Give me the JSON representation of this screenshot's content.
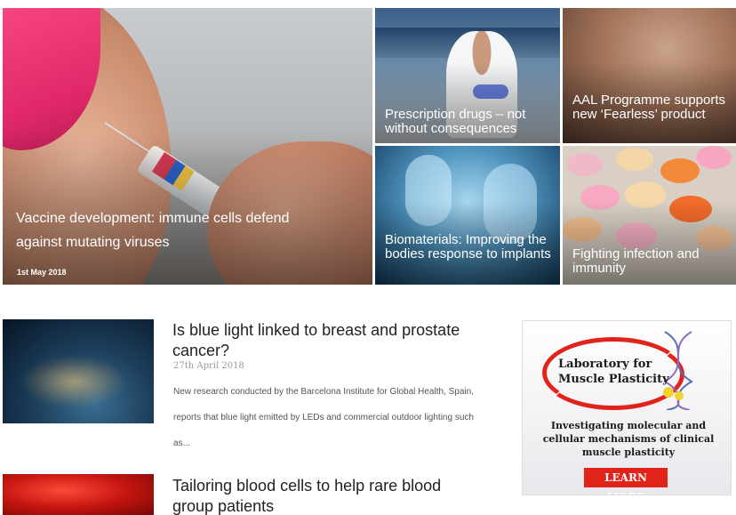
{
  "hero": {
    "title": "Vaccine development: immune cells defend against mutating viruses",
    "date": "1st May 2018"
  },
  "tiles": [
    {
      "label": "Prescription drugs – not without consequences"
    },
    {
      "label": "AAL Programme supports new ‘Fearless’ product"
    },
    {
      "label": "Biomaterials: Improving the bodies response to implants"
    },
    {
      "label": "Fighting infection and immunity"
    }
  ],
  "stories": [
    {
      "title": "Is blue light linked to breast and prostate cancer?",
      "date": "27th April 2018",
      "excerpt": "New research conducted by the Barcelona Institute for Global Health, Spain, reports that blue light emitted by LEDs and commercial outdoor lighting such as..."
    },
    {
      "title": "Tailoring blood cells to help rare blood group patients"
    }
  ],
  "ad": {
    "title": "Laboratory for Muscle Plasticity",
    "subtitle": "Investigating molecular and cellular mechanisms of clinical muscle plasticity",
    "button": "LEARN MORE",
    "accent": "#e2231a"
  }
}
